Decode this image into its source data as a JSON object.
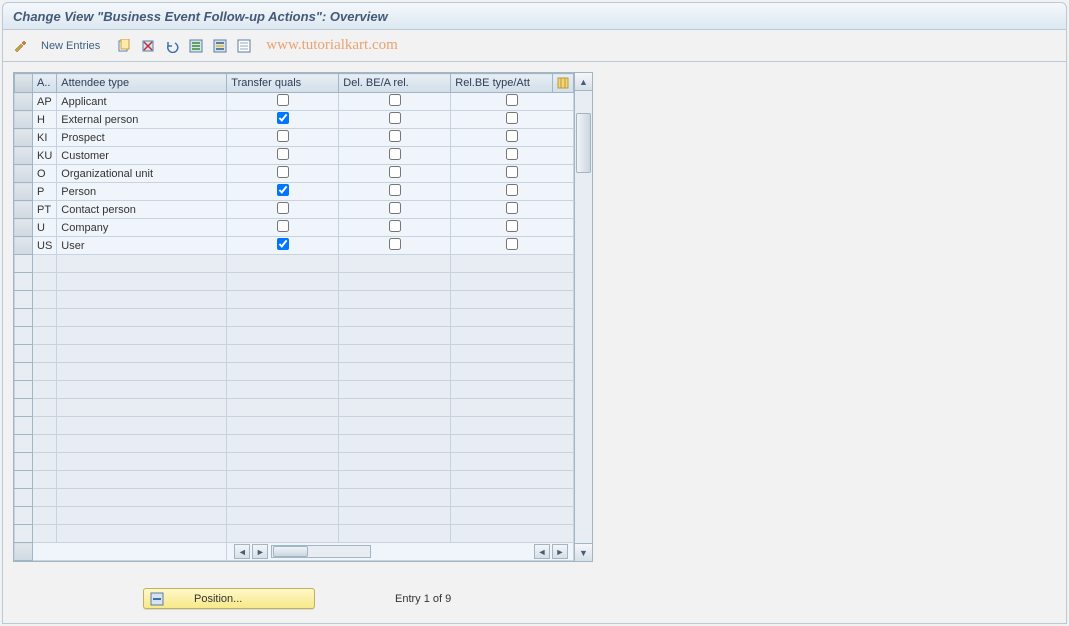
{
  "title": "Change View \"Business Event Follow-up Actions\": Overview",
  "toolbar": {
    "new_entries": "New Entries"
  },
  "watermark": "www.tutorialkart.com",
  "table": {
    "headers": {
      "code": "A..",
      "name": "Attendee type",
      "transfer": "Transfer quals",
      "del_be": "Del. BE/A rel.",
      "rel_be": "Rel.BE type/Att"
    },
    "rows": [
      {
        "code": "AP",
        "name": "Applicant",
        "transfer": false,
        "del_be": false,
        "rel_be": false
      },
      {
        "code": "H",
        "name": "External person",
        "transfer": true,
        "del_be": false,
        "rel_be": false
      },
      {
        "code": "KI",
        "name": "Prospect",
        "transfer": false,
        "del_be": false,
        "rel_be": false
      },
      {
        "code": "KU",
        "name": "Customer",
        "transfer": false,
        "del_be": false,
        "rel_be": false
      },
      {
        "code": "O",
        "name": "Organizational unit",
        "transfer": false,
        "del_be": false,
        "rel_be": false
      },
      {
        "code": "P",
        "name": "Person",
        "transfer": true,
        "del_be": false,
        "rel_be": false
      },
      {
        "code": "PT",
        "name": "Contact person",
        "transfer": false,
        "del_be": false,
        "rel_be": false
      },
      {
        "code": "U",
        "name": "Company",
        "transfer": false,
        "del_be": false,
        "rel_be": false
      },
      {
        "code": "US",
        "name": "User",
        "transfer": true,
        "del_be": false,
        "rel_be": false
      }
    ],
    "empty_rows": 16
  },
  "footer": {
    "position_button": "Position...",
    "entry_text": "Entry 1 of 9"
  }
}
